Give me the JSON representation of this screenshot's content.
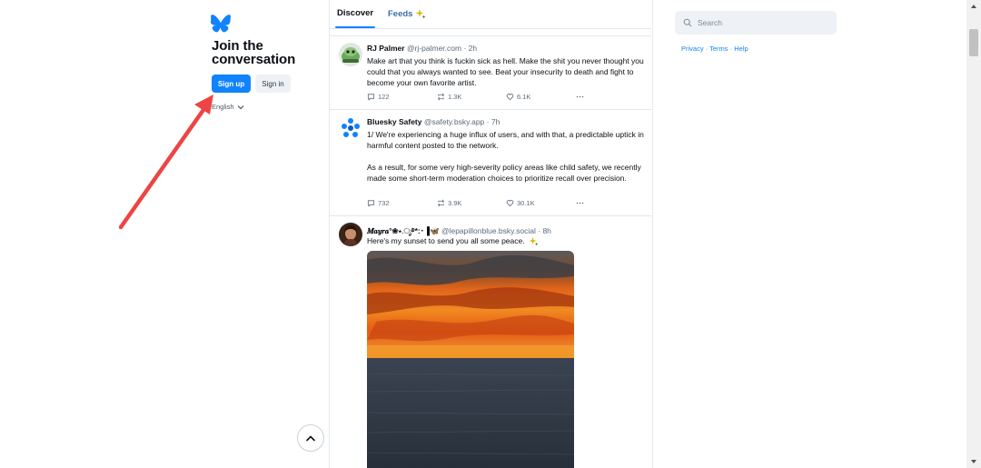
{
  "left_nav": {
    "join_title_line1": "Join the",
    "join_title_line2": "conversation",
    "signup_label": "Sign up",
    "signin_label": "Sign in",
    "language": "English"
  },
  "tabs": {
    "discover": "Discover",
    "feeds": "Feeds"
  },
  "posts": [
    {
      "name": "RJ Palmer",
      "handle": "@rj-palmer.com",
      "time": "· 2h",
      "text": "Make art that you think is fuckin sick as hell. Make the shit you never thought you could that you always wanted to see. Beat your insecurity to death and fight to become your own favorite artist.",
      "replies": "122",
      "reposts": "1.3K",
      "likes": "6.1K"
    },
    {
      "name": "Bluesky Safety",
      "handle": "@safety.bsky.app",
      "time": "· 7h",
      "text_p1": "1/ We're experiencing a huge influx of users, and with that, a predictable uptick in harmful content posted to the network.",
      "text_p2": "As a result, for some very high-severity policy areas like child safety, we recently made some short-term moderation choices to prioritize recall over precision.",
      "replies": "732",
      "reposts": "3.9K",
      "likes": "30.1K"
    },
    {
      "name": "𝑴𝒂𝒚𝒓𝒂°❀⋆.ೃ࿔*:･▐🦋",
      "handle": "@lepapillonblue.bsky.social",
      "time": "· 8h",
      "text": "Here's my sunset to send you all some peace."
    }
  ],
  "search": {
    "placeholder": "Search"
  },
  "links": {
    "privacy": "Privacy",
    "terms": "Terms",
    "help": "Help",
    "separator": "·"
  },
  "colors": {
    "accent": "#1083fe",
    "annotation_arrow": "#ee4444"
  }
}
